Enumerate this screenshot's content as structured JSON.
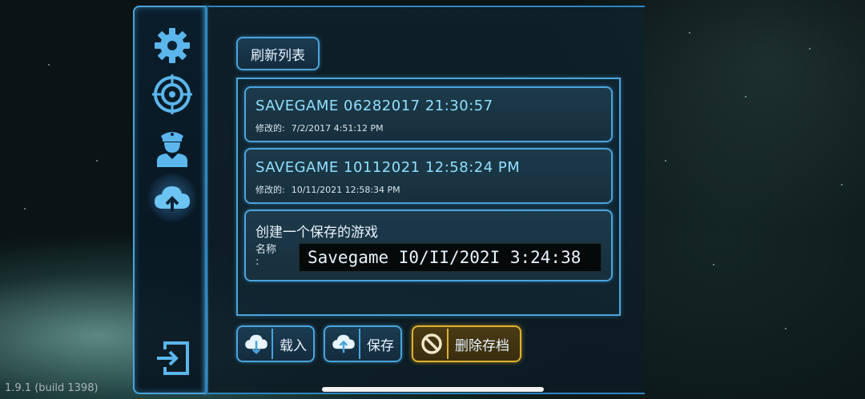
{
  "sidebar": {
    "items": [
      {
        "name": "settings",
        "icon": "gear-icon",
        "active": false
      },
      {
        "name": "target",
        "icon": "crosshair-icon",
        "active": false
      },
      {
        "name": "captain",
        "icon": "captain-icon",
        "active": false
      },
      {
        "name": "cloud-save",
        "icon": "cloud-upload-icon",
        "active": true
      }
    ],
    "exit_icon": "exit-icon"
  },
  "toolbar": {
    "refresh_label": "刷新列表"
  },
  "saves": [
    {
      "title": "SAVEGAME 06282017 21:30:57",
      "modified_label": "修改的:",
      "modified": "7/2/2017 4:51:12 PM"
    },
    {
      "title": "SAVEGAME 10112021 12:58:24 PM",
      "modified_label": "修改的:",
      "modified": "10/11/2021 12:58:34 PM"
    }
  ],
  "create": {
    "title": "创建一个保存的游戏",
    "name_label": "名称\n:",
    "name_value": "Savegame I0/II/202I 3:24:38"
  },
  "actions": {
    "load_label": "载入",
    "save_label": "保存",
    "delete_label": "删除存档"
  },
  "colors": {
    "accent": "#4aa4dc",
    "title_text": "#8fe0ff",
    "warning": "#e0b030"
  },
  "version": "1.9.1 (build 1398)"
}
